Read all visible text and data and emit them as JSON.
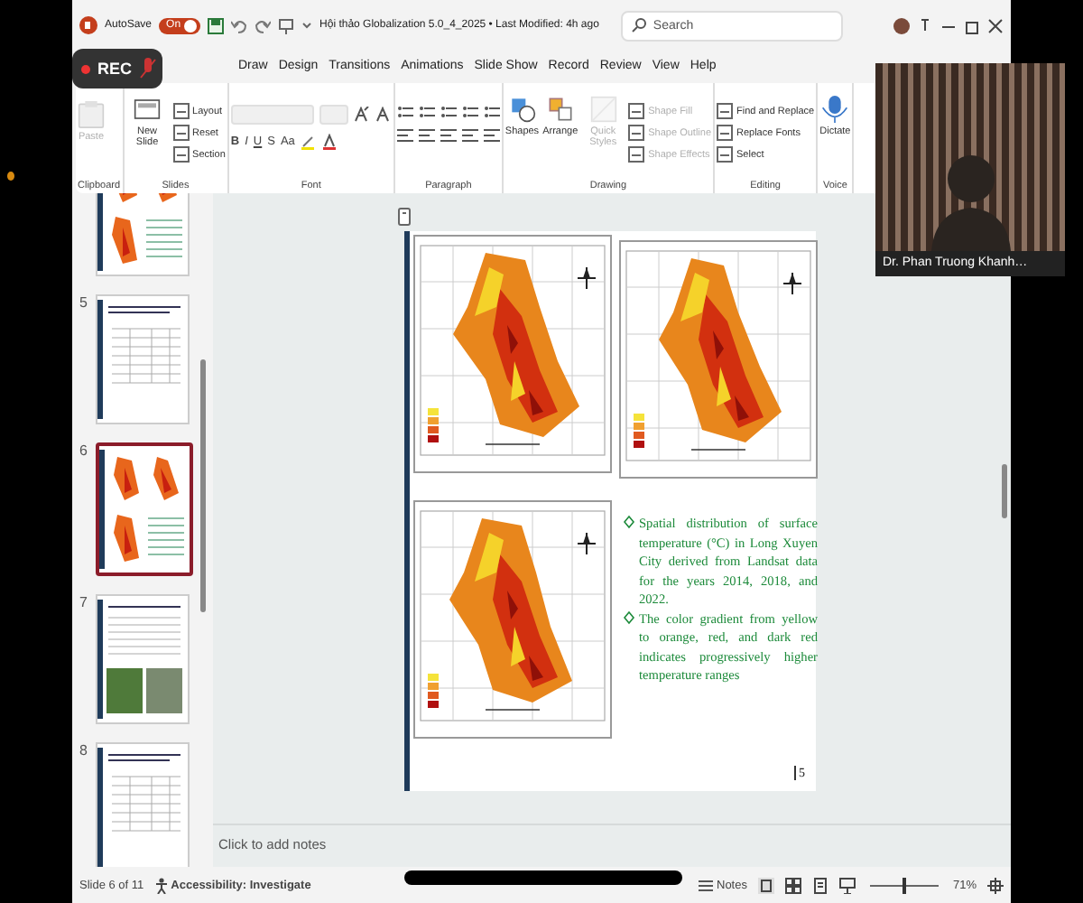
{
  "title_bar": {
    "autosave_label": "AutoSave",
    "autosave_on": true,
    "toggle_text": "On",
    "document_title": "Hội thảo Globalization 5.0_4_2025 • Last Modified: 4h ago",
    "search": {
      "placeholder": "Search"
    }
  },
  "recording": {
    "label": "REC"
  },
  "tabs": [
    {
      "label": "Draw",
      "selected": false
    },
    {
      "label": "Design",
      "selected": false
    },
    {
      "label": "Transitions",
      "selected": false
    },
    {
      "label": "Animations",
      "selected": false
    },
    {
      "label": "Slide Show",
      "selected": false
    },
    {
      "label": "Record",
      "selected": false
    },
    {
      "label": "Review",
      "selected": false
    },
    {
      "label": "View",
      "selected": false
    },
    {
      "label": "Help",
      "selected": false
    }
  ],
  "ribbon": {
    "groups": [
      {
        "name": "Clipboard",
        "kind": "commands",
        "commands": [
          {
            "kind": "large",
            "label": "Paste",
            "disabled": true
          }
        ]
      },
      {
        "name": "Slides",
        "kind": "commands",
        "commands": [
          {
            "kind": "large",
            "label": "New Slide",
            "disabled": false
          },
          {
            "kind": "small",
            "label": "Layout",
            "disabled": false
          },
          {
            "kind": "small",
            "label": "Reset",
            "disabled": false
          },
          {
            "kind": "small",
            "label": "Section",
            "disabled": false
          }
        ]
      },
      {
        "name": "Font",
        "kind": "font",
        "commands": [
          {
            "kind": "glyph",
            "label": "B",
            "disabled": false
          },
          {
            "kind": "glyph",
            "label": "I",
            "disabled": false
          },
          {
            "kind": "glyph",
            "label": "U",
            "disabled": false
          },
          {
            "kind": "glyph",
            "label": "S",
            "disabled": false
          },
          {
            "kind": "glyph",
            "label": "Aa",
            "disabled": false
          }
        ]
      },
      {
        "name": "Paragraph",
        "kind": "paragraph"
      },
      {
        "name": "Drawing",
        "kind": "commands",
        "commands": [
          {
            "kind": "large",
            "label": "Shapes",
            "disabled": false
          },
          {
            "kind": "large",
            "label": "Arrange",
            "disabled": false
          },
          {
            "kind": "large",
            "label": "Quick Styles",
            "disabled": true
          },
          {
            "kind": "small",
            "label": "Shape Fill",
            "disabled": true
          },
          {
            "kind": "small",
            "label": "Shape Outline",
            "disabled": true
          },
          {
            "kind": "small",
            "label": "Shape Effects",
            "disabled": true
          }
        ]
      },
      {
        "name": "Editing",
        "kind": "commands",
        "commands": [
          {
            "kind": "small",
            "label": "Find and Replace",
            "disabled": false
          },
          {
            "kind": "small",
            "label": "Replace Fonts",
            "disabled": false
          },
          {
            "kind": "small",
            "label": "Select",
            "disabled": false
          }
        ]
      },
      {
        "name": "Voice",
        "kind": "commands",
        "commands": [
          {
            "kind": "large",
            "label": "Dictate",
            "disabled": false
          }
        ]
      }
    ]
  },
  "thumbnails": [
    {
      "kind": "maps",
      "selected": false
    },
    {
      "number": "5",
      "kind": "table",
      "selected": false
    },
    {
      "number": "6",
      "kind": "maps",
      "selected": true
    },
    {
      "number": "7",
      "kind": "photos",
      "selected": false
    },
    {
      "number": "8",
      "kind": "table",
      "selected": false
    }
  ],
  "slide": {
    "bullets": [
      "Spatial distribution of surface temperature (°C) in Long Xuyen City derived from Landsat data for the years 2014, 2018, and 2022.",
      "The color gradient from yellow to orange, red, and dark red indicates progressively higher temperature ranges"
    ],
    "page_number": "5"
  },
  "notes": {
    "placeholder": "Click to add notes"
  },
  "status_bar": {
    "slide_info": "Slide 6 of 11",
    "accessibility": "Accessibility: Investigate",
    "notes_label": "Notes",
    "zoom": {
      "level": 0.5
    },
    "zoom_text": "71%"
  },
  "webcam": {
    "name": "Dr. Phan Truong Khanh…"
  }
}
